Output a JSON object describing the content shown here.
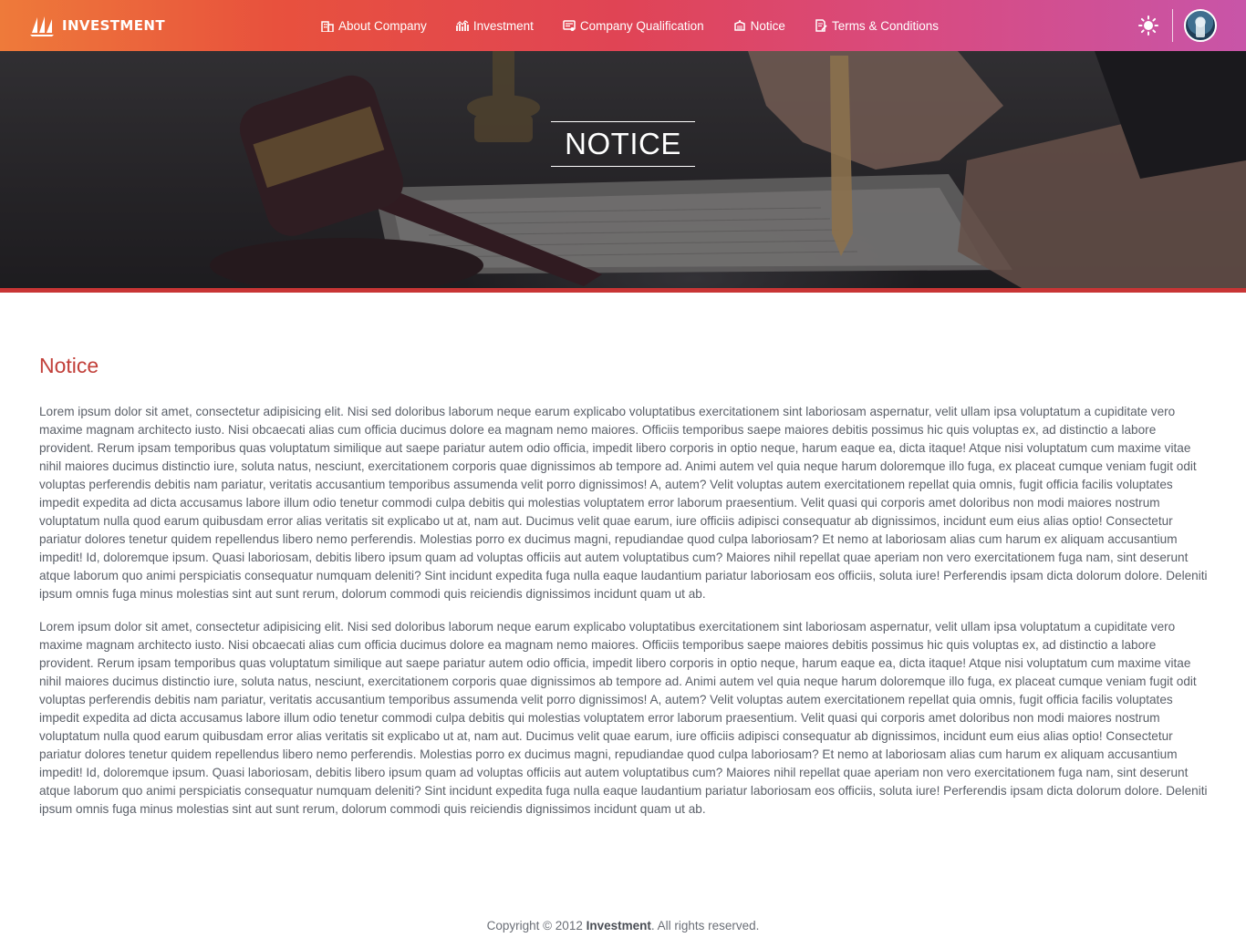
{
  "navbar": {
    "brand": "INVESTMENT",
    "items": [
      {
        "label": "About Company",
        "icon": "building-icon"
      },
      {
        "label": "Investment",
        "icon": "chart-icon"
      },
      {
        "label": "Company Qualification",
        "icon": "certificate-icon"
      },
      {
        "label": "Notice",
        "icon": "megaphone-icon"
      },
      {
        "label": "Terms & Conditions",
        "icon": "document-edit-icon"
      }
    ],
    "theme_toggle_icon": "sun-icon",
    "avatar_icon": "user-avatar"
  },
  "hero": {
    "title": "NOTICE"
  },
  "main": {
    "section_title": "Notice",
    "paragraphs": [
      "Lorem ipsum dolor sit amet, consectetur adipisicing elit. Nisi sed doloribus laborum neque earum explicabo voluptatibus exercitationem sint laboriosam aspernatur, velit ullam ipsa voluptatum a cupiditate vero maxime magnam architecto iusto. Nisi obcaecati alias cum officia ducimus dolore ea magnam nemo maiores. Officiis temporibus saepe maiores debitis possimus hic quis voluptas ex, ad distinctio a labore provident. Rerum ipsam temporibus quas voluptatum similique aut saepe pariatur autem odio officia, impedit libero corporis in optio neque, harum eaque ea, dicta itaque! Atque nisi voluptatum cum maxime vitae nihil maiores ducimus distinctio iure, soluta natus, nesciunt, exercitationem corporis quae dignissimos ab tempore ad. Animi autem vel quia neque harum doloremque illo fuga, ex placeat cumque veniam fugit odit voluptas perferendis debitis nam pariatur, veritatis accusantium temporibus assumenda velit porro dignissimos! A, autem? Velit voluptas autem exercitationem repellat quia omnis, fugit officia facilis voluptates impedit expedita ad dicta accusamus labore illum odio tenetur commodi culpa debitis qui molestias voluptatem error laborum praesentium. Velit quasi qui corporis amet doloribus non modi maiores nostrum voluptatum nulla quod earum quibusdam error alias veritatis sit explicabo ut at, nam aut. Ducimus velit quae earum, iure officiis adipisci consequatur ab dignissimos, incidunt eum eius alias optio! Consectetur pariatur dolores tenetur quidem repellendus libero nemo perferendis. Molestias porro ex ducimus magni, repudiandae quod culpa laboriosam? Et nemo at laboriosam alias cum harum ex aliquam accusantium impedit! Id, doloremque ipsum. Quasi laboriosam, debitis libero ipsum quam ad voluptas officiis aut autem voluptatibus cum? Maiores nihil repellat quae aperiam non vero exercitationem fuga nam, sint deserunt atque laborum quo animi perspiciatis consequatur numquam deleniti? Sint incidunt expedita fuga nulla eaque laudantium pariatur laboriosam eos officiis, soluta iure! Perferendis ipsam dicta dolorum dolore. Deleniti ipsum omnis fuga minus molestias sint aut sunt rerum, dolorum commodi quis reiciendis dignissimos incidunt quam ut ab.",
      "Lorem ipsum dolor sit amet, consectetur adipisicing elit. Nisi sed doloribus laborum neque earum explicabo voluptatibus exercitationem sint laboriosam aspernatur, velit ullam ipsa voluptatum a cupiditate vero maxime magnam architecto iusto. Nisi obcaecati alias cum officia ducimus dolore ea magnam nemo maiores. Officiis temporibus saepe maiores debitis possimus hic quis voluptas ex, ad distinctio a labore provident. Rerum ipsam temporibus quas voluptatum similique aut saepe pariatur autem odio officia, impedit libero corporis in optio neque, harum eaque ea, dicta itaque! Atque nisi voluptatum cum maxime vitae nihil maiores ducimus distinctio iure, soluta natus, nesciunt, exercitationem corporis quae dignissimos ab tempore ad. Animi autem vel quia neque harum doloremque illo fuga, ex placeat cumque veniam fugit odit voluptas perferendis debitis nam pariatur, veritatis accusantium temporibus assumenda velit porro dignissimos! A, autem? Velit voluptas autem exercitationem repellat quia omnis, fugit officia facilis voluptates impedit expedita ad dicta accusamus labore illum odio tenetur commodi culpa debitis qui molestias voluptatem error laborum praesentium. Velit quasi qui corporis amet doloribus non modi maiores nostrum voluptatum nulla quod earum quibusdam error alias veritatis sit explicabo ut at, nam aut. Ducimus velit quae earum, iure officiis adipisci consequatur ab dignissimos, incidunt eum eius alias optio! Consectetur pariatur dolores tenetur quidem repellendus libero nemo perferendis. Molestias porro ex ducimus magni, repudiandae quod culpa laboriosam? Et nemo at laboriosam alias cum harum ex aliquam accusantium impedit! Id, doloremque ipsum. Quasi laboriosam, debitis libero ipsum quam ad voluptas officiis aut autem voluptatibus cum? Maiores nihil repellat quae aperiam non vero exercitationem fuga nam, sint deserunt atque laborum quo animi perspiciatis consequatur numquam deleniti? Sint incidunt expedita fuga nulla eaque laudantium pariatur laboriosam eos officiis, soluta iure! Perferendis ipsam dicta dolorum dolore. Deleniti ipsum omnis fuga minus molestias sint aut sunt rerum, dolorum commodi quis reiciendis dignissimos incidunt quam ut ab."
    ]
  },
  "footer": {
    "prefix": "Copyright © 2012 ",
    "brand": "Investment",
    "suffix": ". All rights reserved."
  },
  "colors": {
    "accent": "#c2403a",
    "hero_border": "#c83535"
  }
}
